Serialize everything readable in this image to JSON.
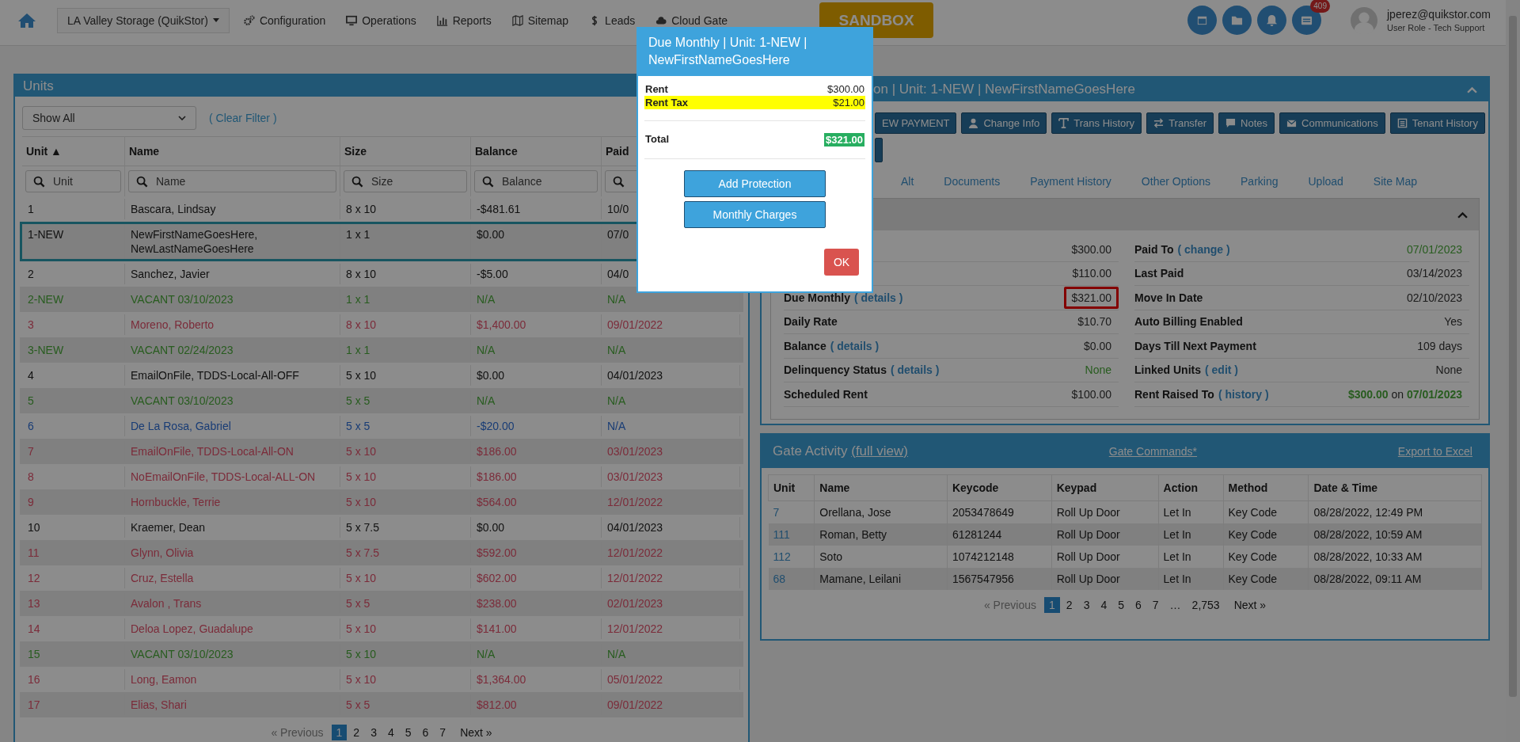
{
  "nav": {
    "location": "LA Valley Storage (QuikStor)",
    "menu": [
      "Configuration",
      "Operations",
      "Reports",
      "Sitemap",
      "Leads",
      "Cloud Gate"
    ],
    "sandbox": "SANDBOX",
    "badge": "409",
    "user": {
      "email": "jperez@quikstor.com",
      "role": "User Role - Tech Support"
    }
  },
  "units": {
    "title": "Units",
    "filter": "Show All",
    "clear_filter": "( Clear Filter )",
    "columns": [
      {
        "label": "Unit ▲",
        "placeholder": "Unit"
      },
      {
        "label": "Name",
        "placeholder": "Name"
      },
      {
        "label": "Size",
        "placeholder": "Size"
      },
      {
        "label": "Balance",
        "placeholder": "Balance"
      },
      {
        "label": "Paid"
      }
    ],
    "rows": [
      {
        "cells": [
          "1",
          "Bascara, Lindsay",
          "8 x 10",
          "-$481.61",
          "10/0"
        ],
        "kind": "occupied",
        "selected": false
      },
      {
        "cells": [
          "1-NEW",
          "NewFirstNameGoesHere, NewLastNameGoesHere",
          "1 x 1",
          "$0.00",
          "07/0"
        ],
        "kind": "occupied",
        "selected": true
      },
      {
        "cells": [
          "2",
          "Sanchez, Javier",
          "8 x 10",
          "-$5.00",
          "04/0"
        ],
        "kind": "occupied",
        "selected": false
      },
      {
        "cells": [
          "2-NEW",
          "VACANT 03/10/2023",
          "1 x 1",
          "N/A",
          "N/A"
        ],
        "kind": "vacant",
        "selected": false
      },
      {
        "cells": [
          "3",
          "Moreno, Roberto",
          "8 x 10",
          "$1,400.00",
          "09/01/2022"
        ],
        "kind": "delinquent",
        "selected": false
      },
      {
        "cells": [
          "3-NEW",
          "VACANT 02/24/2023",
          "1 x 1",
          "N/A",
          "N/A"
        ],
        "kind": "vacant",
        "selected": false
      },
      {
        "cells": [
          "4",
          "EmailOnFile, TDDS-Local-All-OFF",
          "5 x 10",
          "$0.00",
          "04/01/2023"
        ],
        "kind": "occupied",
        "selected": false
      },
      {
        "cells": [
          "5",
          "VACANT 03/10/2023",
          "5 x 5",
          "N/A",
          "N/A"
        ],
        "kind": "vacant",
        "selected": false
      },
      {
        "cells": [
          "6",
          "De La Rosa, Gabriel",
          "5 x 5",
          "-$20.00",
          "N/A"
        ],
        "kind": "credit",
        "selected": false
      },
      {
        "cells": [
          "7",
          "EmailOnFile, TDDS-Local-All-ON",
          "5 x 10",
          "$186.00",
          "03/01/2023"
        ],
        "kind": "delinquent",
        "selected": false
      },
      {
        "cells": [
          "8",
          "NoEmailOnFile, TDDS-Local-ALL-ON",
          "5 x 10",
          "$186.00",
          "03/01/2023"
        ],
        "kind": "delinquent",
        "selected": false
      },
      {
        "cells": [
          "9",
          "Hornbuckle, Terrie",
          "5 x 10",
          "$564.00",
          "12/01/2022"
        ],
        "kind": "delinquent",
        "selected": false
      },
      {
        "cells": [
          "10",
          "Kraemer, Dean",
          "5 x 7.5",
          "$0.00",
          "04/01/2023"
        ],
        "kind": "occupied",
        "selected": false
      },
      {
        "cells": [
          "11",
          "Glynn, Olivia",
          "5 x 7.5",
          "$592.00",
          "12/01/2022"
        ],
        "kind": "delinquent",
        "selected": false
      },
      {
        "cells": [
          "12",
          "Cruz, Estella",
          "5 x 10",
          "$602.00",
          "12/01/2022"
        ],
        "kind": "delinquent",
        "selected": false
      },
      {
        "cells": [
          "13",
          "Avalon , Trans",
          "5 x 5",
          "$238.00",
          "02/01/2023"
        ],
        "kind": "delinquent",
        "selected": false
      },
      {
        "cells": [
          "14",
          "Deloa Lopez, Guadalupe",
          "5 x 10",
          "$141.00",
          "12/01/2022"
        ],
        "kind": "delinquent",
        "selected": false
      },
      {
        "cells": [
          "15",
          "VACANT 03/10/2023",
          "5 x 10",
          "N/A",
          "N/A"
        ],
        "kind": "vacant",
        "selected": false
      },
      {
        "cells": [
          "16",
          "Long, Eamon",
          "5 x 10",
          "$1,364.00",
          "05/01/2022"
        ],
        "kind": "delinquent",
        "selected": false
      },
      {
        "cells": [
          "17",
          "Elias, Shari",
          "5 x 5",
          "$812.00",
          "09/01/2022"
        ],
        "kind": "delinquent",
        "selected": false
      }
    ],
    "pagination": {
      "previous": "« Previous",
      "previous_disabled": true,
      "pages": [
        {
          "label": "1",
          "selected": true
        },
        {
          "label": "2",
          "selected": false
        },
        {
          "label": "3",
          "selected": false
        },
        {
          "label": "4",
          "selected": false
        },
        {
          "label": "5",
          "selected": false
        },
        {
          "label": "6",
          "selected": false
        },
        {
          "label": "7",
          "selected": false
        }
      ],
      "next": "Next »"
    }
  },
  "tenant": {
    "title": "on | Unit: 1-NEW | NewFirstNameGoesHere",
    "buttons": [
      "EW PAYMENT",
      "Change Info",
      "Trans History",
      "Transfer",
      "Notes",
      "Communications",
      "Tenant History"
    ],
    "tabs": [
      {
        "label": "Alt",
        "selected": false
      },
      {
        "label": "Documents",
        "selected": false
      },
      {
        "label": "Payment History",
        "selected": false
      },
      {
        "label": "Other Options",
        "selected": false
      },
      {
        "label": "Parking",
        "selected": false
      },
      {
        "label": "Upload",
        "selected": false
      },
      {
        "label": "Site Map",
        "selected": false
      }
    ],
    "left_fields": [
      {
        "value": "$300.00",
        "kind": "plain",
        "highlighted": false
      },
      {
        "value": "$110.00",
        "kind": "plain",
        "highlighted": false
      },
      {
        "label": "Due Monthly",
        "link": "( details )",
        "value": "$321.00",
        "kind": "plain",
        "highlighted": true
      },
      {
        "label": "Daily Rate",
        "value": "$10.70",
        "kind": "plain",
        "highlighted": false
      },
      {
        "label": "Balance",
        "link": "( details )",
        "value": "$0.00",
        "kind": "plain",
        "highlighted": false
      },
      {
        "label": "Delinquency Status",
        "link": "( details )",
        "value": "None",
        "kind": "good",
        "highlighted": false
      },
      {
        "label": "Scheduled Rent",
        "value": "$100.00",
        "kind": "plain",
        "highlighted": false
      }
    ],
    "right_fields": [
      {
        "label": "Paid To",
        "link": "( change )",
        "value": "07/01/2023",
        "kind": "good"
      },
      {
        "label": "Last Paid",
        "value": "03/14/2023",
        "kind": "plain"
      },
      {
        "label": "Move In Date",
        "value": "02/10/2023",
        "kind": "plain"
      },
      {
        "label": "Auto Billing Enabled",
        "value": "Yes",
        "kind": "plain"
      },
      {
        "label": "Days Till Next Payment",
        "value": "109 days",
        "kind": "plain"
      },
      {
        "label": "Linked Units",
        "link": "( edit )",
        "value": "None",
        "kind": "plain"
      },
      {
        "label": "Rent Raised To",
        "link": "( history )",
        "value": "**$300.00** on **07/01/2023**",
        "kind": "plain"
      }
    ]
  },
  "gate": {
    "title": "Gate Activity",
    "full_view": "(full view)",
    "commands": "Gate Commands*",
    "export": "Export to Excel",
    "columns": [
      "Unit",
      "Name",
      "Keycode",
      "Keypad",
      "Action",
      "Method",
      "Date & Time"
    ],
    "rows": [
      [
        "7",
        "Orellana, Jose",
        "2053478649",
        "Roll Up Door",
        "Let In",
        "Key Code",
        "08/28/2022, 12:49 PM"
      ],
      [
        "111",
        "Roman, Betty",
        "61281244",
        "Roll Up Door",
        "Let In",
        "Key Code",
        "08/28/2022, 10:59 AM"
      ],
      [
        "112",
        "Soto",
        "1074212148",
        "Roll Up Door",
        "Let In",
        "Key Code",
        "08/28/2022, 10:33 AM"
      ],
      [
        "68",
        "Mamane, Leilani",
        "1567547956",
        "Roll Up Door",
        "Let In",
        "Key Code",
        "08/28/2022, 09:11 AM"
      ]
    ],
    "pagination": {
      "previous": "« Previous",
      "previous_disabled": true,
      "pages": [
        {
          "label": "1",
          "selected": true
        },
        {
          "label": "2",
          "selected": false
        },
        {
          "label": "3",
          "selected": false
        },
        {
          "label": "4",
          "selected": false
        },
        {
          "label": "5",
          "selected": false
        },
        {
          "label": "6",
          "selected": false
        },
        {
          "label": "7",
          "selected": false
        },
        {
          "label": "…",
          "selected": false
        },
        {
          "label": "2,753",
          "selected": false
        }
      ],
      "next": "Next »"
    }
  },
  "modal": {
    "title": "Due Monthly | Unit: 1-NEW | NewFirstNameGoesHere",
    "charges": [
      {
        "label": "Rent",
        "amount": "$300.00",
        "highlighted": false
      },
      {
        "label": "Rent Tax",
        "amount": "$21.00",
        "highlighted": true
      }
    ],
    "total_label": "Total",
    "total": "$321.00",
    "buttons": [
      "Add Protection",
      "Monthly Charges"
    ],
    "ok": "OK"
  }
}
